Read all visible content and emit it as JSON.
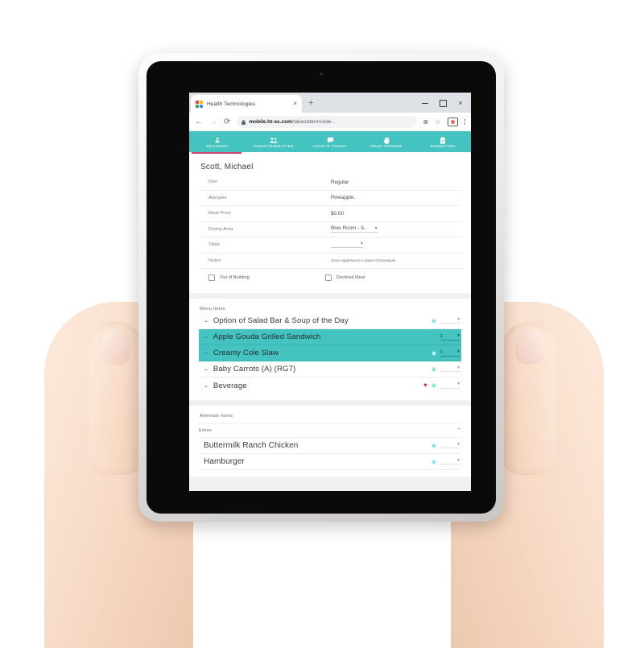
{
  "browser": {
    "tab": {
      "title": "Health Technologies",
      "close_label": "×",
      "favicon": "chrome-favicon"
    },
    "new_tab_label": "+",
    "window_controls": {
      "minimize": "minimize-icon",
      "maximize": "maximize-icon",
      "close": "×"
    },
    "nav": {
      "back": "←",
      "forward": "→",
      "reload": "⟳"
    },
    "url": {
      "domain": "mobile.ht-ss.com",
      "path": "/takeorder/reside…",
      "lock": "lock-icon"
    },
    "omnibox_icons": {
      "install": "⊕",
      "bookmark": "☆",
      "cast": "cast-icon"
    },
    "menu": "kebab-menu-icon"
  },
  "appbar": {
    "tabs": [
      {
        "label": "RESIDENT",
        "icon": "person-icon",
        "glyph": "●",
        "active": true
      },
      {
        "label": "GUEST/EMPLOYEE",
        "icon": "people-icon",
        "glyph": "●",
        "active": false
      },
      {
        "label": "COOK'S TICKET",
        "icon": "chat-icon",
        "glyph": "■",
        "active": false
      },
      {
        "label": "HELD ORDERS",
        "icon": "hand-icon",
        "glyph": "✋",
        "active": false
      },
      {
        "label": "SUBMITTED",
        "icon": "clipboard-check-icon",
        "glyph": "☑",
        "active": false
      }
    ],
    "accent": "#45c3c0",
    "indicator": "#d0436a"
  },
  "resident": {
    "name": "Scott, Michael",
    "fields": [
      {
        "label": "Diet",
        "value": "Regular",
        "type": "text"
      },
      {
        "label": "Allergies",
        "value": "Pineapple;",
        "type": "text"
      },
      {
        "label": "Meal Price",
        "value": "$0.00",
        "type": "text"
      },
      {
        "label": "Dining Area",
        "value": "Blue Room - IL",
        "type": "select"
      },
      {
        "label": "Table",
        "value": "",
        "type": "select"
      },
      {
        "label": "Notes",
        "value": "Serve applesauce in place of pineapple.",
        "type": "note"
      }
    ],
    "checkboxes": [
      {
        "label": "Out of Building",
        "checked": false
      },
      {
        "label": "Declined Meal",
        "checked": false
      }
    ]
  },
  "menu_items": {
    "title": "Menu Items",
    "rows": [
      {
        "name": "Option of Salad Bar & Soup of the Day",
        "selected": false,
        "favorite": false,
        "diamond": true,
        "qty": ""
      },
      {
        "name": "Apple Gouda Grilled Sandwich",
        "selected": true,
        "favorite": false,
        "diamond": false,
        "qty": "1"
      },
      {
        "name": "Creamy Cole Slaw",
        "selected": true,
        "favorite": false,
        "diamond": true,
        "qty": "1"
      },
      {
        "name": "Baby Carrots (A) (RG7)",
        "selected": false,
        "favorite": false,
        "diamond": true,
        "qty": ""
      },
      {
        "name": "Beverage",
        "selected": false,
        "favorite": true,
        "diamond": true,
        "qty": ""
      }
    ]
  },
  "alternate_items": {
    "title": "Alternate Items",
    "category": {
      "name": "Entree",
      "collapse_icon": "chevron-up-icon"
    },
    "rows": [
      {
        "name": "Buttermilk Ranch Chicken",
        "diamond": true,
        "qty": ""
      },
      {
        "name": "Hamburger",
        "diamond": true,
        "qty": ""
      }
    ]
  }
}
